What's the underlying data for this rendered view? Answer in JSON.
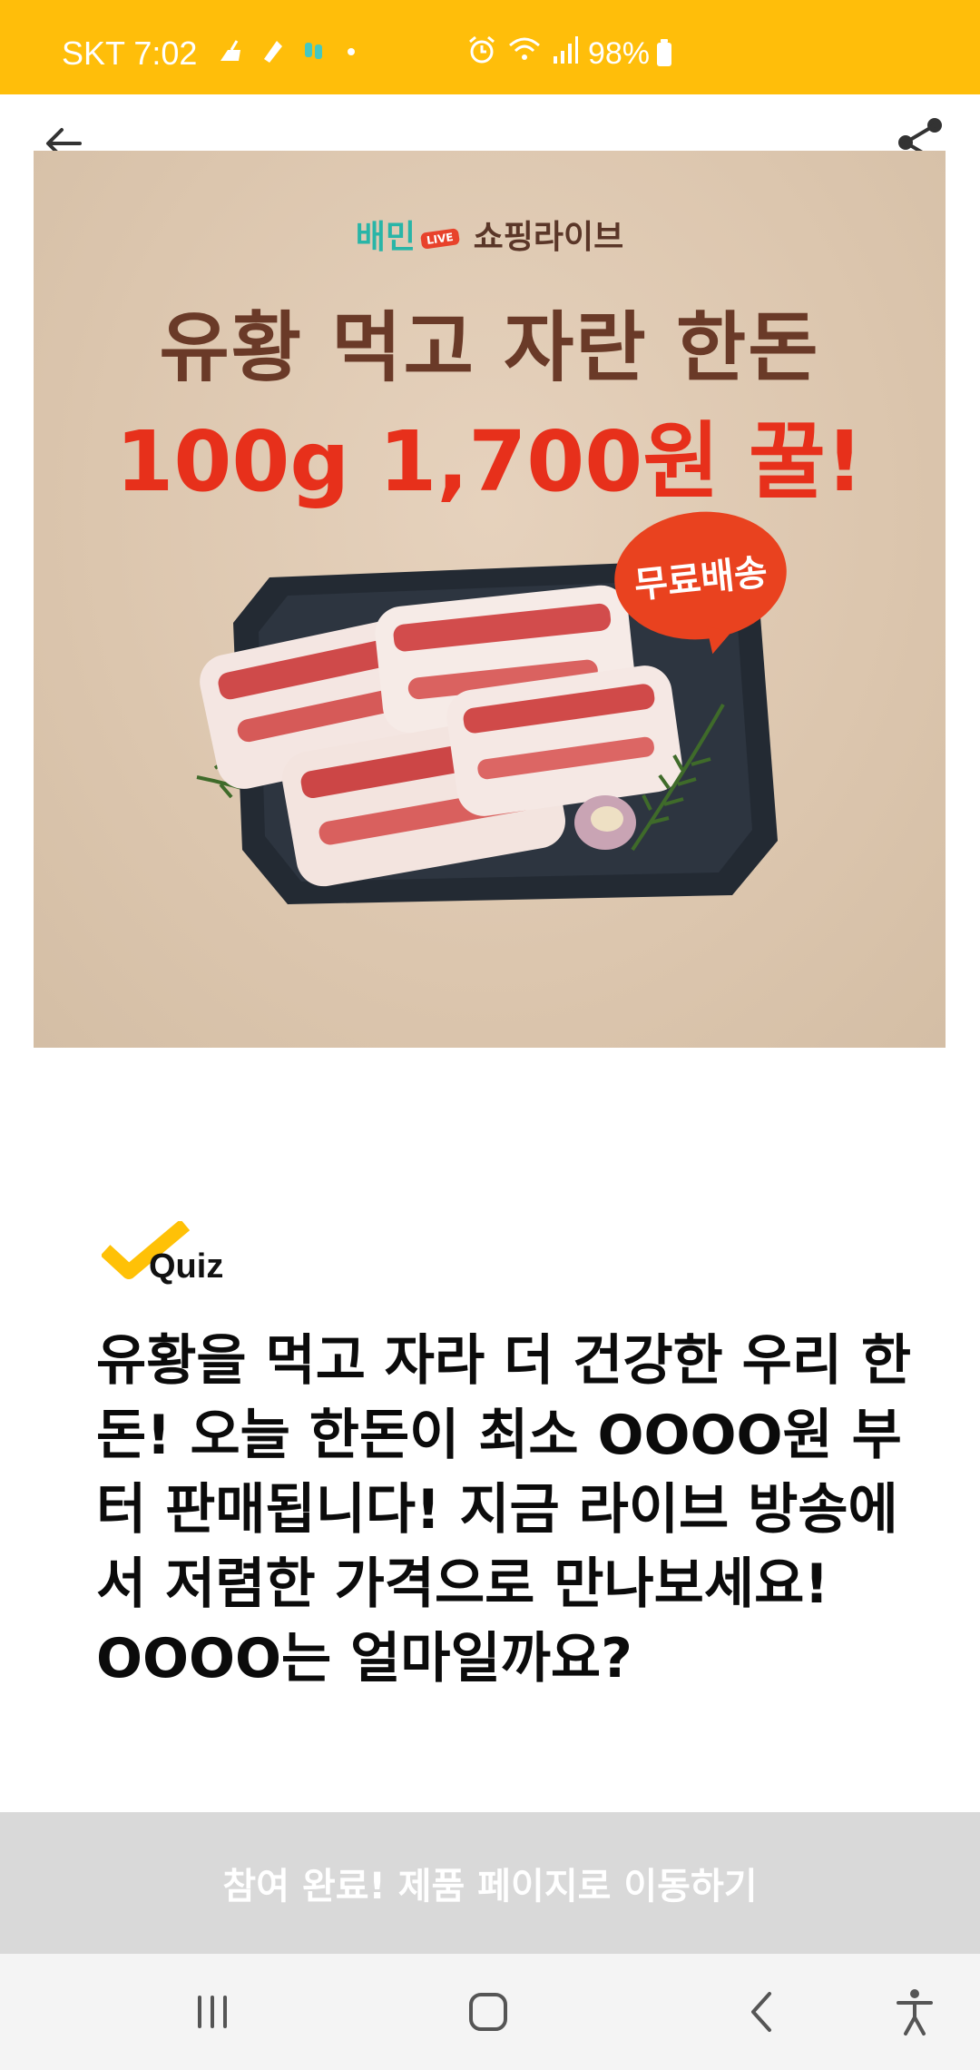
{
  "status_bar": {
    "carrier_time": "SKT 7:02",
    "battery": "98%",
    "icons": [
      "broom-icon",
      "notification-icon",
      "app-icon",
      "dot-icon",
      "alarm-icon",
      "wifi-icon",
      "signal-icon",
      "battery-icon"
    ]
  },
  "header": {
    "back_icon": "arrow-left-icon",
    "share_icon": "share-icon"
  },
  "banner": {
    "brand_left": "배민",
    "brand_tag": "LIVE",
    "brand_right": "쇼핑라이브",
    "headline_line1": "유황 먹고 자란 한돈",
    "headline_line2": "100g 1,700원 꿀!",
    "badge": "무료배송"
  },
  "quiz": {
    "label": "Quiz",
    "question": "유황을 먹고 자라 더 건강한 우리 한돈! 오늘 한돈이 최소 OOOO원 부터 판매됩니다! 지금 라이브 방송에서 저렴한 가격으로 만나보세요! OOOO는 얼마일까요?"
  },
  "cta": {
    "label": "참여 완료! 제품 페이지로 이동하기"
  },
  "nav_bar": {
    "icons": [
      "recents-icon",
      "home-icon",
      "back-icon",
      "accessibility-icon"
    ]
  },
  "colors": {
    "status_bar": "#FFBE0A",
    "headline_brown": "#6a3a28",
    "headline_red": "#e7301b",
    "cta_background": "#d9d9d9",
    "quiz_check": "#FFC107"
  }
}
